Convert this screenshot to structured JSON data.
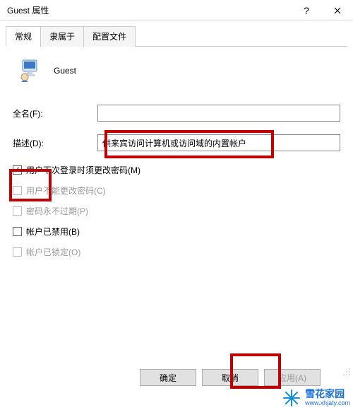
{
  "window": {
    "title": "Guest 属性",
    "help": "?",
    "close": "×"
  },
  "tabs": [
    {
      "label": "常规",
      "active": true
    },
    {
      "label": "隶属于",
      "active": false
    },
    {
      "label": "配置文件",
      "active": false
    }
  ],
  "user": {
    "name": "Guest"
  },
  "fields": {
    "fullname_label": "全名(F):",
    "fullname_value": "",
    "desc_label": "描述(D):",
    "desc_value": "供来宾访问计算机或访问域的内置帐户"
  },
  "checks": {
    "must_change": "用户下次登录时须更改密码(M)",
    "cannot_change": "用户不能更改密码(C)",
    "never_expire": "密码永不过期(P)",
    "disabled": "帐户已禁用(B)",
    "locked": "帐户已锁定(O)"
  },
  "buttons": {
    "ok": "确定",
    "cancel": "取消",
    "apply": "应用(A)"
  },
  "watermark": {
    "brand": "雪花家园",
    "url": "www.xhjaty.com"
  }
}
